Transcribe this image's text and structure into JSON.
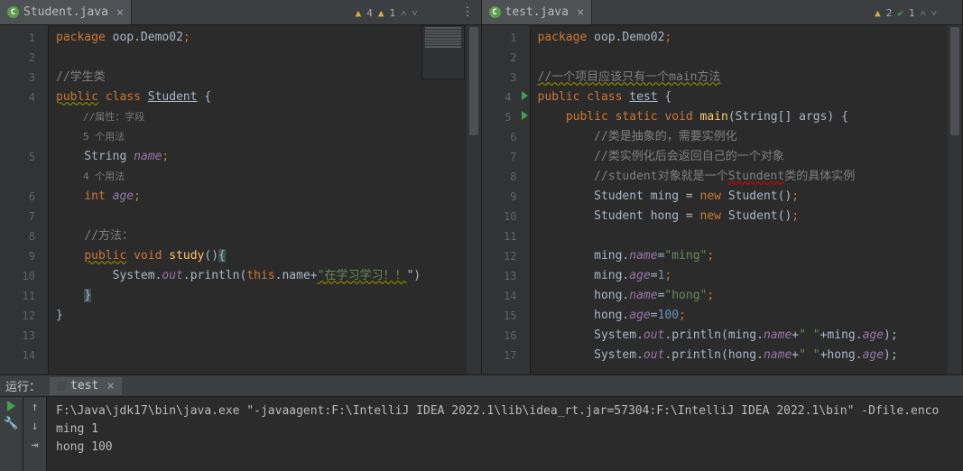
{
  "left": {
    "tab": {
      "file": "Student.java"
    },
    "status": {
      "weak": "4",
      "warn": "1"
    },
    "lines": [
      {
        "n": 1,
        "seg": [
          [
            "kw",
            "package "
          ],
          [
            "",
            "oop.Demo02"
          ],
          [
            "kw",
            ";"
          ]
        ]
      },
      {
        "n": 2,
        "seg": []
      },
      {
        "n": 3,
        "seg": [
          [
            "cm",
            "//学生类"
          ]
        ]
      },
      {
        "n": 4,
        "seg": [
          [
            "kw warn",
            "public"
          ],
          [
            "kw",
            " class "
          ],
          [
            "uline",
            "Student"
          ],
          [
            "",
            " {"
          ]
        ]
      },
      {
        "n": "",
        "usage": "//属性：字段"
      },
      {
        "n": "",
        "usage": "5 个用法"
      },
      {
        "n": 5,
        "seg": [
          [
            "",
            "    String "
          ],
          [
            "fld",
            "name"
          ],
          [
            "kw",
            ";"
          ]
        ]
      },
      {
        "n": "",
        "usage": "4 个用法"
      },
      {
        "n": 6,
        "seg": [
          [
            "",
            "    "
          ],
          [
            "kw",
            "int "
          ],
          [
            "fld",
            "age"
          ],
          [
            "kw",
            ";"
          ]
        ]
      },
      {
        "n": 7,
        "seg": []
      },
      {
        "n": 8,
        "seg": [
          [
            "",
            "    "
          ],
          [
            "cm",
            "//方法："
          ]
        ]
      },
      {
        "n": 9,
        "seg": [
          [
            "",
            "    "
          ],
          [
            "kw warn",
            "public"
          ],
          [
            "kw",
            " void "
          ],
          [
            "mth",
            "study"
          ],
          [
            "",
            "()"
          ],
          [
            "hlbrace",
            "{"
          ]
        ]
      },
      {
        "n": 10,
        "seg": [
          [
            "",
            "        System."
          ],
          [
            "fld",
            "out"
          ],
          [
            "",
            ".println("
          ],
          [
            "kw",
            "this"
          ],
          [
            "",
            ".name+"
          ],
          [
            "str warn",
            "\"在学习学习！！"
          ],
          [
            "",
            "\")"
          ]
        ]
      },
      {
        "n": 11,
        "seg": [
          [
            "",
            "    "
          ],
          [
            "hlbrace",
            "}"
          ]
        ]
      },
      {
        "n": 12,
        "seg": [
          [
            "",
            "}"
          ]
        ]
      },
      {
        "n": 13,
        "seg": []
      },
      {
        "n": 14,
        "seg": []
      }
    ]
  },
  "right": {
    "tab": {
      "file": "test.java"
    },
    "status": {
      "warn": "2",
      "ok": "1"
    },
    "lines": [
      {
        "n": 1,
        "seg": [
          [
            "kw",
            "package "
          ],
          [
            "",
            "oop.Demo02"
          ],
          [
            "kw",
            ";"
          ]
        ]
      },
      {
        "n": 2,
        "seg": []
      },
      {
        "n": 3,
        "seg": [
          [
            "cm warn",
            "//一个项目应该只有一个main方法"
          ]
        ]
      },
      {
        "n": 4,
        "run": true,
        "seg": [
          [
            "kw",
            "public class "
          ],
          [
            "warn uline",
            "test"
          ],
          [
            "",
            " {"
          ]
        ]
      },
      {
        "n": 5,
        "run": true,
        "seg": [
          [
            "",
            "    "
          ],
          [
            "kw",
            "public static void "
          ],
          [
            "mth",
            "main"
          ],
          [
            "",
            "(String[] args) {"
          ]
        ]
      },
      {
        "n": 6,
        "seg": [
          [
            "",
            "        "
          ],
          [
            "cm",
            "//类是抽象的，需要实例化"
          ]
        ]
      },
      {
        "n": 7,
        "seg": [
          [
            "",
            "        "
          ],
          [
            "cm",
            "//类实例化后会返回自己的一个对象"
          ]
        ]
      },
      {
        "n": 8,
        "seg": [
          [
            "",
            "        "
          ],
          [
            "cm",
            "//student对象就是一个"
          ],
          [
            "cm err",
            "Stundent"
          ],
          [
            "cm",
            "类的具体实例"
          ]
        ]
      },
      {
        "n": 9,
        "seg": [
          [
            "",
            "        Student ming = "
          ],
          [
            "kw",
            "new "
          ],
          [
            "",
            "Student()"
          ],
          [
            "kw",
            ";"
          ]
        ]
      },
      {
        "n": 10,
        "seg": [
          [
            "",
            "        Student hong = "
          ],
          [
            "kw",
            "new "
          ],
          [
            "",
            "Student()"
          ],
          [
            "kw",
            ";"
          ]
        ]
      },
      {
        "n": 11,
        "seg": []
      },
      {
        "n": 12,
        "seg": [
          [
            "",
            "        ming."
          ],
          [
            "fld",
            "name"
          ],
          [
            "",
            "="
          ],
          [
            "str",
            "\"ming\""
          ],
          [
            "kw",
            ";"
          ]
        ]
      },
      {
        "n": 13,
        "seg": [
          [
            "",
            "        ming."
          ],
          [
            "fld",
            "age"
          ],
          [
            "",
            "="
          ],
          [
            "num",
            "1"
          ],
          [
            "kw",
            ";"
          ]
        ]
      },
      {
        "n": 14,
        "seg": [
          [
            "",
            "        hong."
          ],
          [
            "fld",
            "name"
          ],
          [
            "",
            "="
          ],
          [
            "str",
            "\"hong\""
          ],
          [
            "kw",
            ";"
          ]
        ]
      },
      {
        "n": 15,
        "seg": [
          [
            "",
            "        hong."
          ],
          [
            "fld",
            "age"
          ],
          [
            "",
            "="
          ],
          [
            "num",
            "100"
          ],
          [
            "kw",
            ";"
          ]
        ]
      },
      {
        "n": 16,
        "seg": [
          [
            "",
            "        System."
          ],
          [
            "fld",
            "out"
          ],
          [
            "",
            ".println(ming."
          ],
          [
            "fld",
            "name"
          ],
          [
            "",
            "+"
          ],
          [
            "str",
            "\" \""
          ],
          [
            "",
            "+ming."
          ],
          [
            "fld",
            "age"
          ],
          [
            "",
            ");"
          ]
        ]
      },
      {
        "n": 17,
        "seg": [
          [
            "",
            "        System."
          ],
          [
            "fld",
            "out"
          ],
          [
            "",
            ".println(hong."
          ],
          [
            "fld",
            "name"
          ],
          [
            "",
            "+"
          ],
          [
            "str",
            "\" \""
          ],
          [
            "",
            "+hong."
          ],
          [
            "fld",
            "age"
          ],
          [
            "",
            ");"
          ]
        ]
      }
    ]
  },
  "run": {
    "label": "运行：",
    "tab": "test",
    "cmd": "F:\\Java\\jdk17\\bin\\java.exe \"-javaagent:F:\\IntelliJ IDEA 2022.1\\lib\\idea_rt.jar=57304:F:\\IntelliJ IDEA 2022.1\\bin\" -Dfile.enco",
    "out1": "ming 1",
    "out2": "hong 100"
  }
}
